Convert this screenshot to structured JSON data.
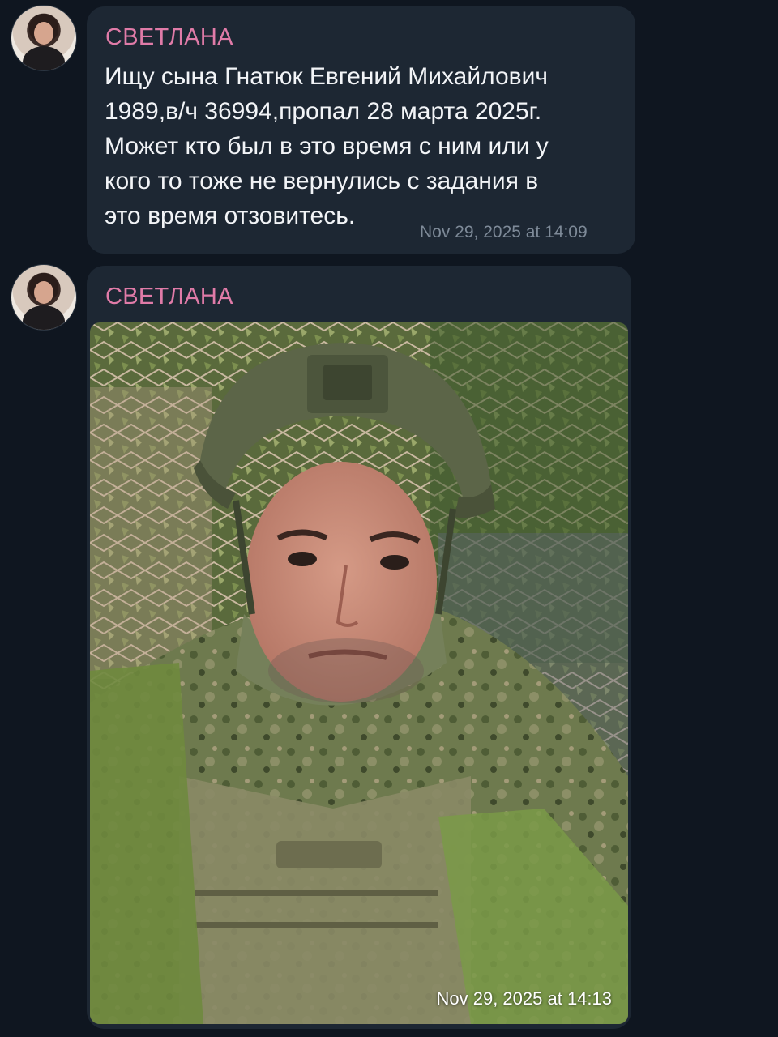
{
  "messages": [
    {
      "sender": "СВЕТЛАНА",
      "text": "Ищу сына Гнатюк Евгений Михайлович\n1989,в/ч 36994,пропал 28 марта 2025г.\nМожет кто был в это время с ним или у\nкого то тоже не вернулись с задания в\nэто время отзовитесь.",
      "timestamp": "Nov 29, 2025 at 14:09"
    },
    {
      "sender": "СВЕТЛАНА",
      "photo": "selfie of soldier in helmet and camouflage",
      "timestamp": "Nov 29, 2025 at 14:13"
    }
  ],
  "colors": {
    "background": "#0f1620",
    "bubble": "#1d2733",
    "sender": "#e07ba8",
    "text": "#f2f4f7",
    "timestamp": "#7e8a98"
  }
}
